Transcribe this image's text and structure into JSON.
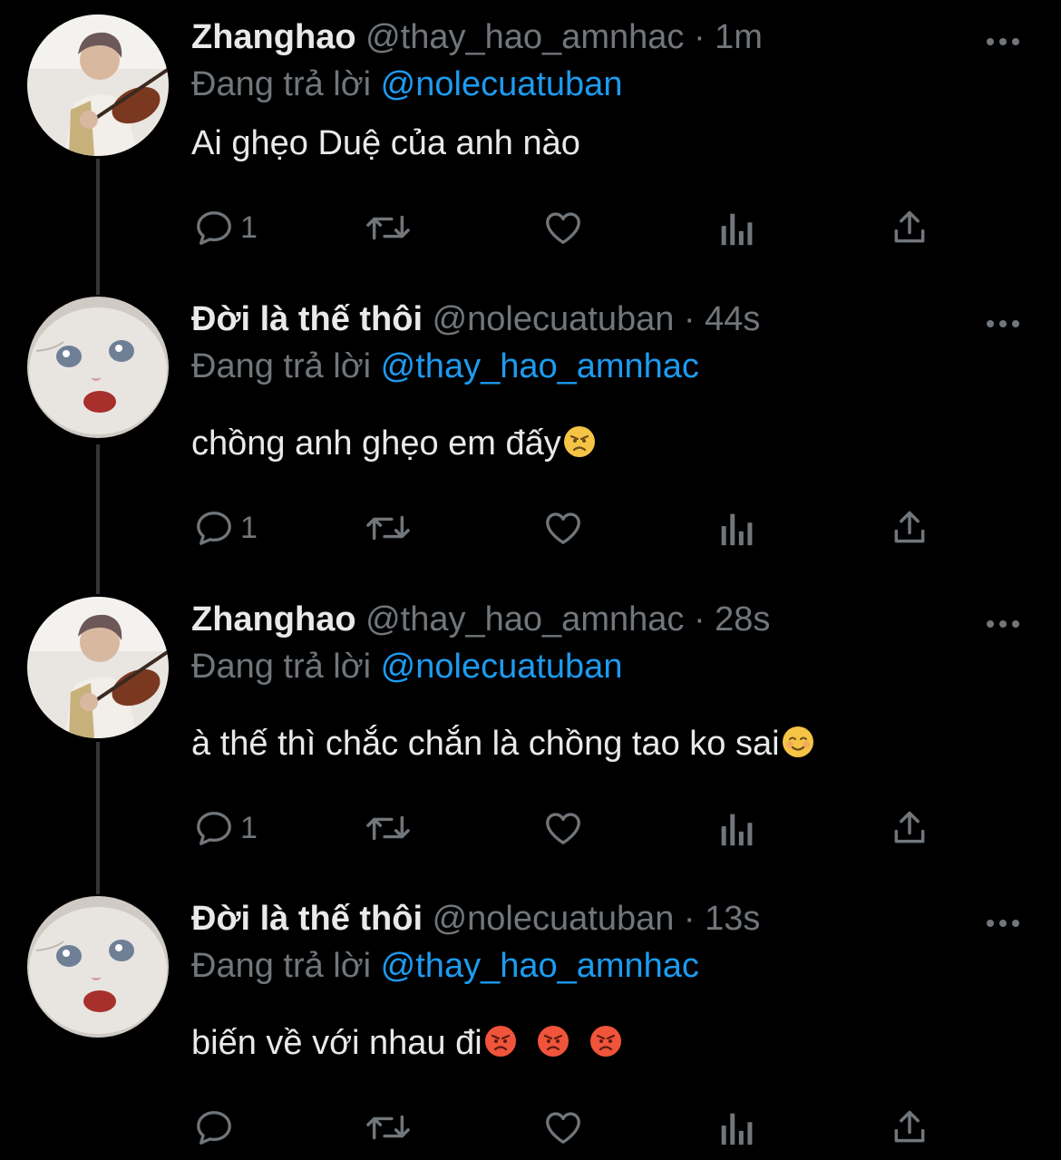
{
  "tweets": [
    {
      "name": "Zhanghao",
      "handle": "@thay_hao_amnhac",
      "separator": "·",
      "time": "1m",
      "reply_prefix": "Đang trả lời",
      "reply_to": "@nolecuatuban",
      "text": "Ai ghẹo Duệ của anh nào",
      "reply_count": "1",
      "avatar": "violinist-photo"
    },
    {
      "name": "Đời là thế thôi",
      "handle": "@nolecuatuban",
      "separator": "·",
      "time": "44s",
      "reply_prefix": "Đang trả lời",
      "reply_to": "@thay_hao_amnhac",
      "text": "chồng anh ghẹo em đấy",
      "emojis": [
        "angry-face"
      ],
      "reply_count": "1",
      "avatar": "white-kitten-photo"
    },
    {
      "name": "Zhanghao",
      "handle": "@thay_hao_amnhac",
      "separator": "·",
      "time": "28s",
      "reply_prefix": "Đang trả lời",
      "reply_to": "@nolecuatuban",
      "text": "à thế thì chắc chắn là chồng tao ko sai",
      "emojis": [
        "relieved-smile"
      ],
      "reply_count": "1",
      "avatar": "violinist-photo"
    },
    {
      "name": "Đời là thế thôi",
      "handle": "@nolecuatuban",
      "separator": "·",
      "time": "13s",
      "reply_prefix": "Đang trả lời",
      "reply_to": "@thay_hao_amnhac",
      "text": "biến về với nhau đi",
      "emojis": [
        "pouting-face",
        "pouting-face",
        "pouting-face"
      ],
      "reply_count": "",
      "avatar": "white-kitten-photo"
    }
  ],
  "icons": {
    "reply": "reply-icon",
    "retweet": "retweet-icon",
    "like": "heart-icon",
    "views": "analytics-icon",
    "share": "share-icon",
    "more": "more-icon"
  },
  "colors": {
    "background": "#000000",
    "text": "#e7e9ea",
    "muted": "#71767b",
    "link": "#1d9bf0",
    "thread_line": "#333639"
  }
}
